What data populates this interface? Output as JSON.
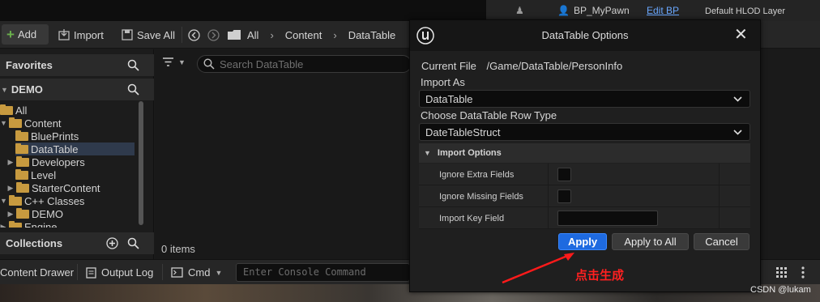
{
  "topbar": {
    "user_label": "BP_MyPawn",
    "edit_label": "Edit BP",
    "hlod_label": "Default HLOD Layer"
  },
  "toolbar": {
    "add_label": "Add",
    "import_label": "Import",
    "save_all_label": "Save All",
    "breadcrumb": [
      "All",
      "Content",
      "DataTable"
    ]
  },
  "left_panel": {
    "favorites_label": "Favorites",
    "project_label": "DEMO",
    "tree": [
      {
        "label": "All"
      },
      {
        "label": "Content"
      },
      {
        "label": "BluePrints"
      },
      {
        "label": "DataTable"
      },
      {
        "label": "Developers"
      },
      {
        "label": "Level"
      },
      {
        "label": "StarterContent"
      },
      {
        "label": "C++ Classes"
      },
      {
        "label": "DEMO"
      },
      {
        "label": "Engine"
      }
    ],
    "collections_label": "Collections"
  },
  "main": {
    "search_placeholder": "Search DataTable",
    "item_count": "0 items"
  },
  "bottombar": {
    "content_drawer_label": "Content Drawer",
    "output_log_label": "Output Log",
    "cmd_label": "Cmd",
    "console_placeholder": "Enter Console Command"
  },
  "dialog": {
    "title": "DataTable Options",
    "current_file_label": "Current File",
    "current_file_value": "/Game/DataTable/PersonInfo",
    "import_as_label": "Import As",
    "import_as_value": "DataTable",
    "row_type_label": "Choose DataTable Row Type",
    "row_type_value": "DateTableStruct",
    "options_header": "Import Options",
    "options": [
      {
        "label": "Ignore Extra Fields"
      },
      {
        "label": "Ignore Missing Fields"
      },
      {
        "label": "Import Key Field"
      }
    ],
    "apply_label": "Apply",
    "apply_all_label": "Apply to All",
    "cancel_label": "Cancel"
  },
  "annotation": {
    "note": "点击生成",
    "color": "#ff2020"
  },
  "watermark": "CSDN @lukam",
  "colors": {
    "accent": "#1e6ae0",
    "folder": "#c79a3f",
    "selection": "#2f3a4c"
  },
  "icons": [
    "search-icon",
    "filter-icon",
    "folder-icon",
    "close-icon",
    "chevron-down-icon",
    "unreal-logo-icon",
    "plus-icon",
    "save-icon",
    "import-icon",
    "back-icon",
    "forward-icon"
  ]
}
